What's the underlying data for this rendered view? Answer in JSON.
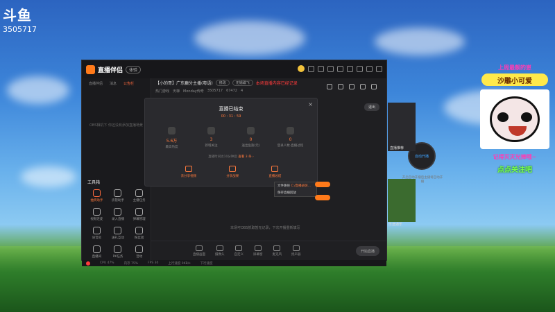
{
  "overlay": {
    "logo": "斗鱼",
    "room_id": "3505717"
  },
  "app": {
    "brand": "直播伴侣",
    "version": "体验"
  },
  "sidebar": {
    "tabs": [
      "直播伴侣",
      "消息",
      "公告栏"
    ],
    "empty_text": "OBS相机下 你还没有添加直播场景",
    "tools_title": "工具箱",
    "tools": [
      {
        "label": "抽奖助手",
        "hot": true
      },
      {
        "label": "房管助手",
        "hot": false
      },
      {
        "label": "主播任务",
        "hot": false
      },
      {
        "label": "视频连麦",
        "hot": false
      },
      {
        "label": "录入直播",
        "hot": false
      },
      {
        "label": "弹幕管理",
        "hot": false
      },
      {
        "label": "语音房",
        "hot": false
      },
      {
        "label": "送礼互动",
        "hot": false
      },
      {
        "label": "粉丝团",
        "hot": false
      },
      {
        "label": "直播间",
        "hot": false
      },
      {
        "label": "PK任务",
        "hot": false
      },
      {
        "label": "活动",
        "hot": false
      }
    ]
  },
  "room": {
    "title": "【小的哥】广东癫分主播(粤语)",
    "edit_label": "修改",
    "category": "无锡磁飞",
    "notice": "本场直播内容已经记录",
    "sub": [
      "热门游戏",
      "天梯",
      "Monday传奇",
      "3505717",
      "67472",
      "4"
    ]
  },
  "hint": "本场可OBS抓取暂无记录，下次开播重新填写",
  "exit_label": "退出",
  "circle_btn": "自动开播",
  "circle_note": "开启自动开播后主播将自动开播",
  "dialog": {
    "title": "直播已结束",
    "time": "00 : 31 : 59",
    "close": "×",
    "stats": [
      {
        "value": "5.6万",
        "label": "最高热度"
      },
      {
        "value": "3",
        "label": "新增关注"
      },
      {
        "value": "0",
        "label": "送出鱼翅(元)"
      },
      {
        "value": "0",
        "label": "登录人数·直播过程"
      }
    ],
    "note_prefix": "直播时间达10分钟后",
    "note_highlight": "查看 3 条  ›",
    "actions": [
      "去分享视频",
      "分享战果",
      "直播总结"
    ]
  },
  "context_menu": {
    "item1": "文件路径",
    "item1_val": "C:/直播录屏...",
    "item2": "保存直播回放"
  },
  "bottombar": [
    "直播画面",
    "摄像头",
    "自定义",
    "屏幕窗",
    "麦克风",
    "扬声器"
  ],
  "start_label": "开始直播",
  "status": [
    "CPU 47%",
    "内存 75%",
    "FPS 30",
    "上行速度 0KB/s",
    "下行速度"
  ],
  "side_labels": {
    "top": "直播推荐",
    "bottom": "乐途通乐"
  },
  "deco": {
    "top": "上周最靓的崽",
    "name": "沙雕小可爱",
    "line1": "记得灭灭光捧哦~",
    "line2": "点点关注吧"
  }
}
